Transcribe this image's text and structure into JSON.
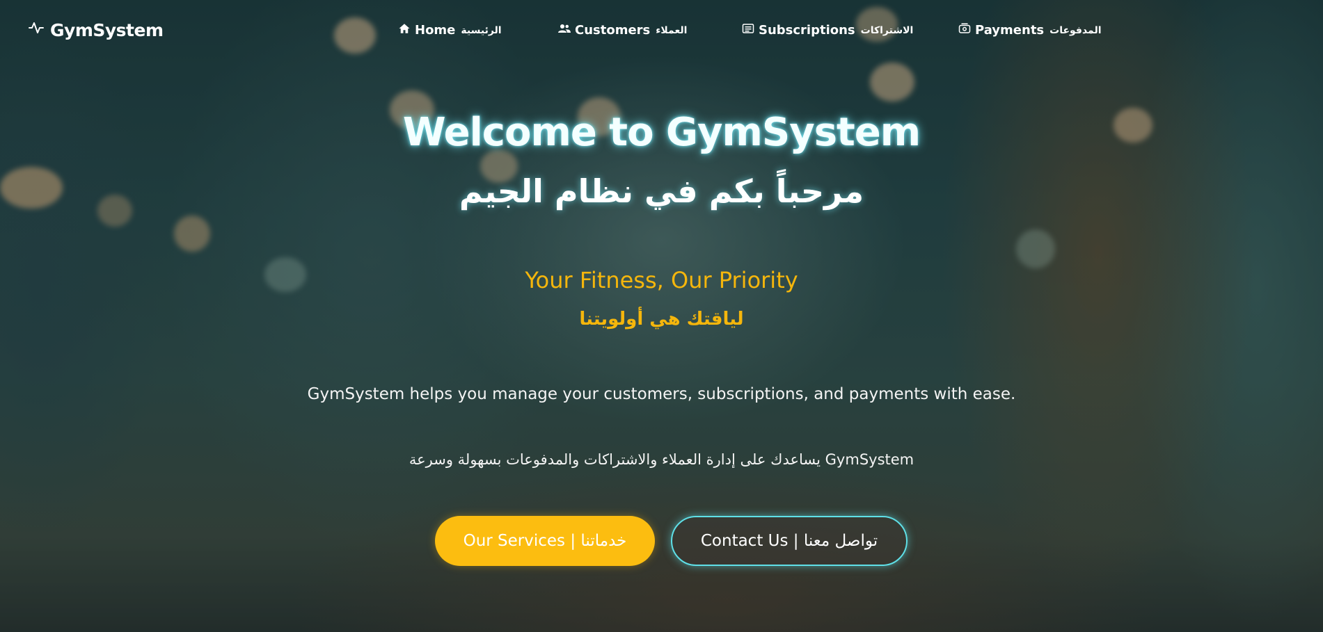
{
  "brand": {
    "name": "GymSystem",
    "icon": "activity-pulse-icon"
  },
  "nav": [
    {
      "id": "home",
      "en": "Home",
      "ar": "الرئيسية",
      "icon": "home-icon"
    },
    {
      "id": "customers",
      "en": "Customers",
      "ar": "العملاء",
      "icon": "users-icon"
    },
    {
      "id": "subscriptions",
      "en": "Subscriptions",
      "ar": "الاشتراكات",
      "icon": "list-card-icon"
    },
    {
      "id": "payments",
      "en": "Payments",
      "ar": "المدفوعات",
      "icon": "money-icon"
    }
  ],
  "hero": {
    "title_en": "Welcome to GymSystem",
    "title_ar": "مرحباً بكم في نظام الجيم",
    "tagline_en": "Your Fitness, Our Priority",
    "tagline_ar": "لياقتك هي أولويتنا",
    "description_en": "GymSystem helps you manage your customers, subscriptions, and payments with ease.",
    "description_ar": "GymSystem يساعدك على إدارة العملاء والاشتراكات والمدفوعات بسهولة وسرعة"
  },
  "buttons": {
    "services": "Our Services | خدماتنا",
    "contact": "Contact Us | تواصل معنا"
  },
  "colors": {
    "accent_yellow": "#fcbd10",
    "accent_cyan": "#5fe0e8",
    "tagline": "#f5b60c"
  }
}
